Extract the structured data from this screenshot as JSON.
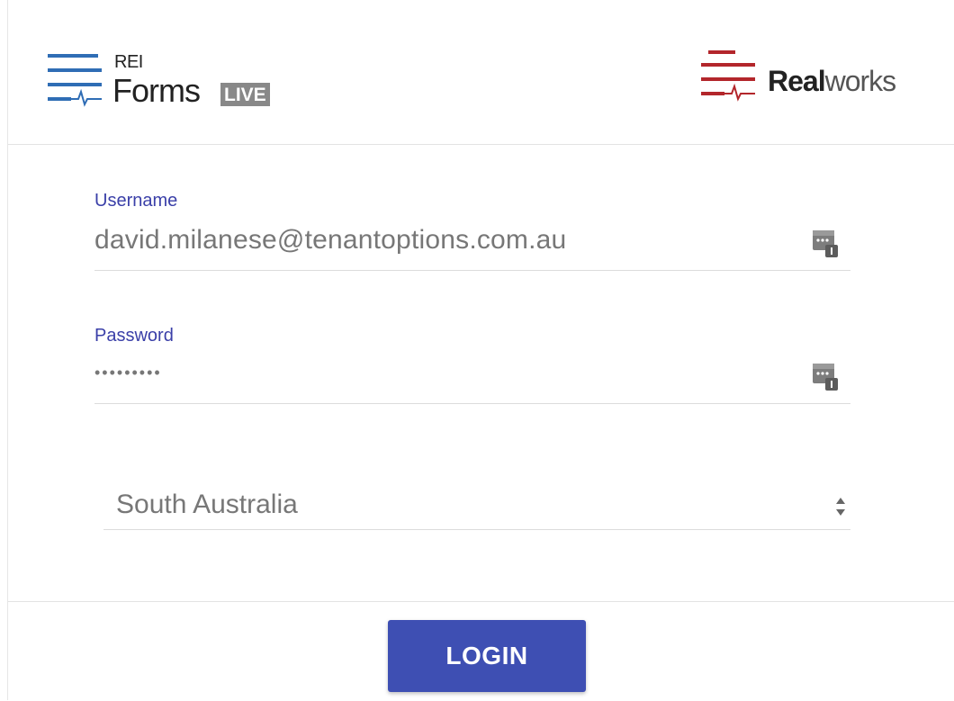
{
  "brand_left": {
    "top_text": "REI",
    "main_text": "Forms",
    "badge_text": "LIVE",
    "color": "#2f6db5"
  },
  "brand_right": {
    "bold_text": "Real",
    "light_text": "works",
    "color": "#b3262b"
  },
  "username": {
    "label": "Username",
    "value": "david.milanese@tenantoptions.com.au",
    "icon": "password-manager-icon"
  },
  "password": {
    "label": "Password",
    "value": "•••••••••",
    "icon": "password-manager-icon"
  },
  "region": {
    "selected": "South Australia"
  },
  "login": {
    "label": "LOGIN",
    "color": "#3e4fb3"
  }
}
